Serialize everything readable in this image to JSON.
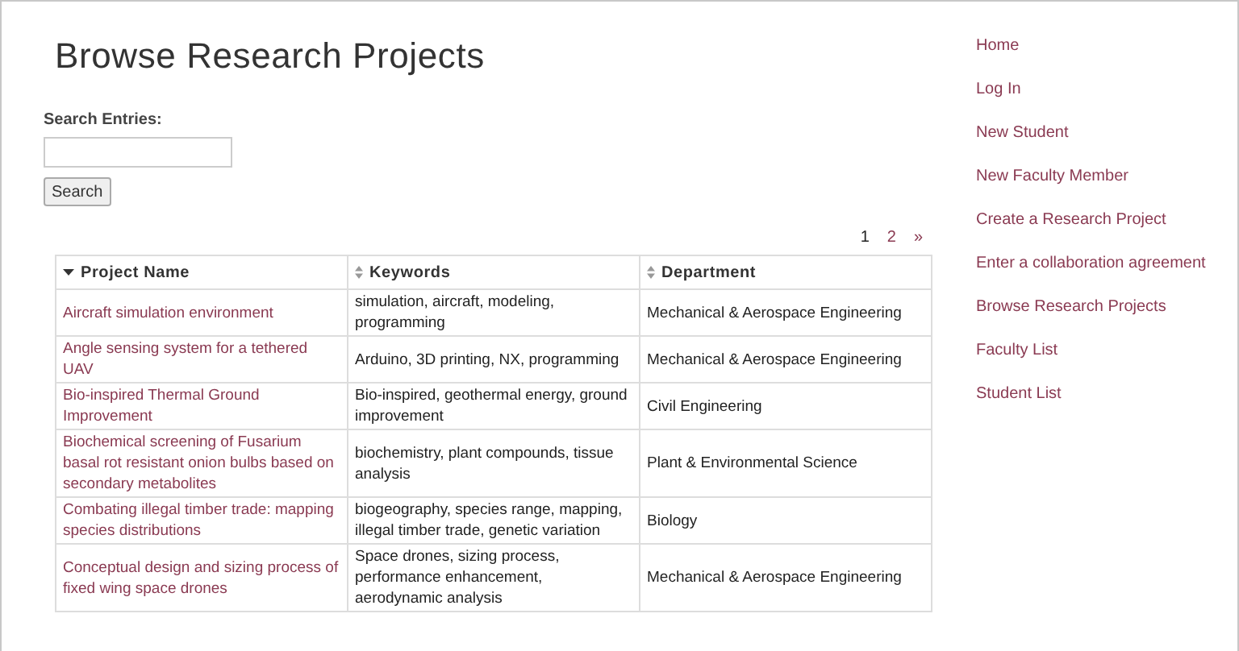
{
  "title": "Browse Research Projects",
  "search": {
    "label": "Search Entries:",
    "button": "Search"
  },
  "pagination": [
    {
      "label": "1",
      "selected": true
    },
    {
      "label": "2",
      "selected": false
    },
    {
      "label": "»",
      "selected": false
    }
  ],
  "table": {
    "columns": [
      {
        "label": "Project Name",
        "sorted": true
      },
      {
        "label": "Keywords",
        "sorted": false
      },
      {
        "label": "Department",
        "sorted": false
      }
    ],
    "rows": [
      [
        "Aircraft simulation environment",
        "simulation, aircraft, modeling, programming",
        "Mechanical & Aerospace Engineering"
      ],
      [
        "Angle sensing system for a tethered UAV",
        "Arduino, 3D printing, NX, programming",
        "Mechanical & Aerospace Engineering"
      ],
      [
        "Bio-inspired Thermal Ground Improvement",
        "Bio-inspired, geothermal energy, ground improvement",
        "Civil Engineering"
      ],
      [
        "Biochemical screening of Fusarium basal rot resistant onion bulbs based on secondary metabolites",
        "biochemistry, plant compounds, tissue analysis",
        "Plant & Environmental Science"
      ],
      [
        "Combating illegal timber trade: mapping species distributions",
        "biogeography, species range, mapping, illegal timber trade, genetic variation",
        "Biology"
      ],
      [
        "Conceptual design and sizing process of fixed wing space drones",
        "Space drones, sizing process, performance enhancement, aerodynamic analysis",
        "Mechanical & Aerospace Engineering"
      ]
    ]
  },
  "sidebar": {
    "items": [
      "Home",
      "Log In",
      "New Student",
      "New Faculty Member",
      "Create a Research Project",
      "Enter a collaboration agreement",
      "Browse Research Projects",
      "Faculty List",
      "Student List"
    ]
  }
}
